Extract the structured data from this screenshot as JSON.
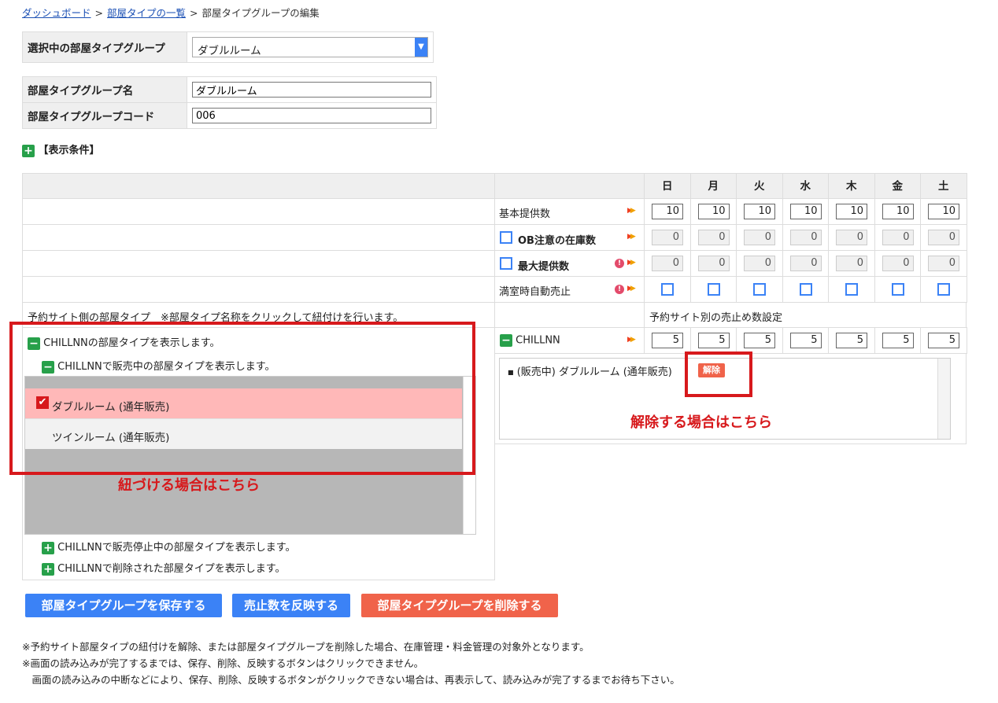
{
  "breadcrumb": {
    "dashboard": "ダッシュボード",
    "room_types": "部屋タイプの一覧",
    "current": "部屋タイプグループの編集",
    "sep": ">"
  },
  "selected_group": {
    "label": "選択中の部屋タイプグループ",
    "value": "ダブルルーム"
  },
  "form": {
    "name_label": "部屋タイプグループ名",
    "name_value": "ダブルルーム",
    "code_label": "部屋タイプグループコード",
    "code_value": "006"
  },
  "display_conditions": "【表示条件】",
  "days": [
    "日",
    "月",
    "火",
    "水",
    "木",
    "金",
    "土"
  ],
  "rows": {
    "base": {
      "label": "基本提供数",
      "values": [
        "10",
        "10",
        "10",
        "10",
        "10",
        "10",
        "10"
      ]
    },
    "ob": {
      "label": "OB注意の在庫数",
      "values": [
        "0",
        "0",
        "0",
        "0",
        "0",
        "0",
        "0"
      ]
    },
    "max": {
      "label": "最大提供数",
      "values": [
        "0",
        "0",
        "0",
        "0",
        "0",
        "0",
        "0"
      ]
    },
    "auto": {
      "label": "満室時自動売止"
    }
  },
  "site_room_type_note": "予約サイト側の部屋タイプ　※部屋タイプ名称をクリックして紐付けを行います。",
  "stop_setting_label": "予約サイト別の売止め数設定",
  "tree": {
    "show_all": "CHILLNNの部屋タイプを表示します。",
    "show_on_sale": "CHILLNNで販売中の部屋タイプを表示します。",
    "items": [
      "ダブルルーム (通年販売)",
      "ツインルーム (通年販売)"
    ],
    "show_stopped": "CHILLNNで販売停止中の部屋タイプを表示します。",
    "show_deleted": "CHILLNNで削除された部屋タイプを表示します。"
  },
  "chillnn": {
    "label": "CHILLNN",
    "values": [
      "5",
      "5",
      "5",
      "5",
      "5",
      "5",
      "5"
    ]
  },
  "linked": {
    "item": "(販売中) ダブルルーム (通年販売)",
    "unlink": "解除"
  },
  "annotations": {
    "link": "紐づける場合はこちら",
    "unlink": "解除する場合はこちら"
  },
  "buttons": {
    "save": "部屋タイプグループを保存する",
    "reflect": "売止数を反映する",
    "delete": "部屋タイプグループを削除する"
  },
  "notes": [
    "※予約サイト部屋タイプの紐付けを解除、または部屋タイプグループを削除した場合、在庫管理・料金管理の対象外となります。",
    "※画面の読み込みが完了するまでは、保存、削除、反映するボタンはクリックできません。",
    "　画面の読み込みの中断などにより、保存、削除、反映するボタンがクリックできない場合は、再表示して、読み込みが完了するまでお待ち下さい。"
  ],
  "colors": {
    "accent_blue": "#3b82f6",
    "danger": "#f0634a",
    "annotation_red": "#d7191c",
    "selected_row": "#ffb8b8"
  }
}
